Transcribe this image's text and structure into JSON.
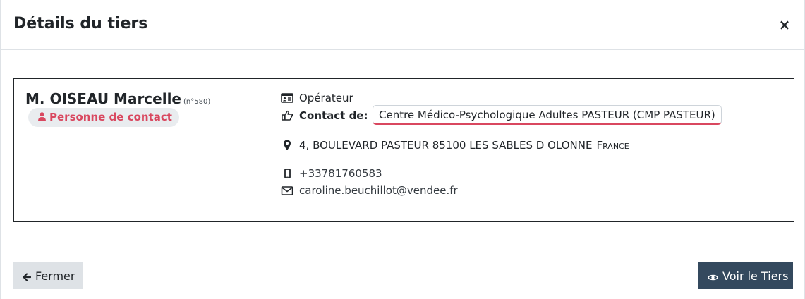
{
  "modal": {
    "title": "Détails du tiers",
    "close_symbol": "×"
  },
  "tiers": {
    "name": "M. OISEAU Marcelle",
    "number": "(n°580)",
    "badge": "Personne de contact",
    "role": "Opérateur",
    "contact_label": "Contact de:",
    "contact_value": "Centre Médico-Psychologique Adultes PASTEUR (CMP PASTEUR)",
    "address": "4, BOULEVARD PASTEUR  85100 LES SABLES D OLONNE",
    "country": "France",
    "phone": "+33781760583",
    "email": "caroline.beuchillot@vendee.fr"
  },
  "footer": {
    "close_label": "Fermer",
    "view_label": "Voir le Tiers"
  },
  "colors": {
    "badge_text": "#d9475f",
    "primary_button": "#34495e",
    "secondary_button": "#dee2e6"
  },
  "icons": {
    "close": "close-icon",
    "person": "user-icon",
    "role": "id-card-icon",
    "contact": "hand-pointing-icon",
    "address": "map-marker-icon",
    "phone": "mobile-phone-icon",
    "email": "envelope-icon",
    "back": "arrow-left-icon",
    "view": "eye-icon"
  }
}
